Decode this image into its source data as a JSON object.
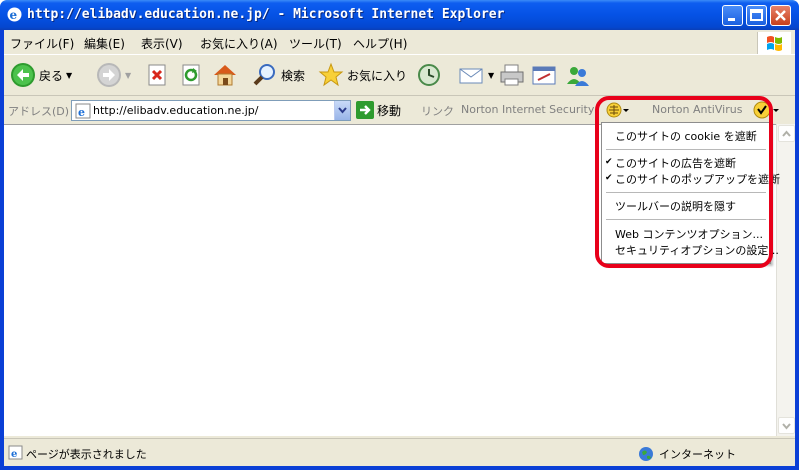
{
  "window": {
    "title": "http://elibadv.education.ne.jp/ - Microsoft Internet Explorer"
  },
  "menu": {
    "items": [
      "ファイル(F)",
      "編集(E)",
      "表示(V)",
      "お気に入り(A)",
      "ツール(T)",
      "ヘルプ(H)"
    ]
  },
  "toolbar": {
    "back_label": "戻る",
    "search_label": "検索",
    "favorites_label": "お気に入り"
  },
  "addressbar": {
    "label": "アドレス(D)",
    "url": "http://elibadv.education.ne.jp/",
    "go_label": "移動",
    "links_label": "リンク",
    "norton_security": "Norton Internet Security",
    "norton_antivirus": "Norton AntiVirus"
  },
  "dropdown": {
    "items": [
      {
        "label": "このサイトの cookie を遮断",
        "checked": false
      },
      {
        "label": "このサイトの広告を遮断",
        "checked": true
      },
      {
        "label": "このサイトのポップアップを遮断",
        "checked": true
      },
      {
        "label": "ツールバーの説明を隠す",
        "checked": false
      },
      {
        "label": "Web コンテンツオプション...",
        "checked": false
      },
      {
        "label": "セキュリティオプションの設定...",
        "checked": false
      }
    ],
    "check_mark": "✔",
    "highlight_color": "#e8001a"
  },
  "statusbar": {
    "status": "ページが表示されました",
    "zone": "インターネット"
  }
}
